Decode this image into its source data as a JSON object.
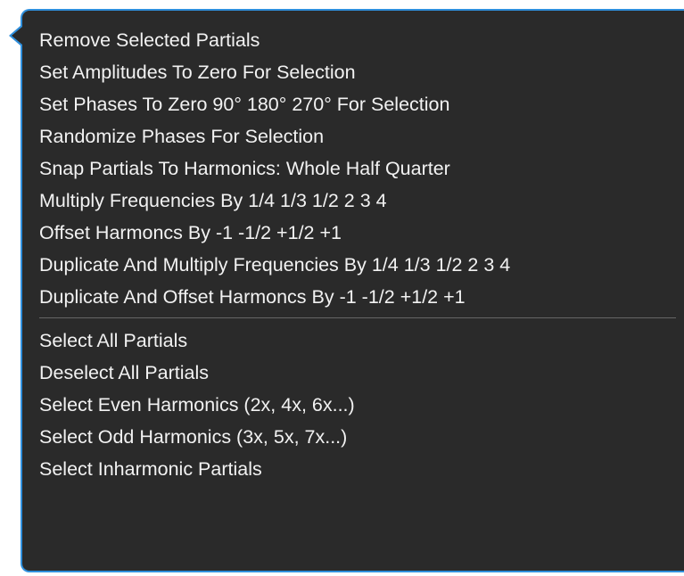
{
  "popup": {
    "border_color": "#2f8fdc",
    "background_color": "#2a2a2a"
  },
  "menu": {
    "group1": [
      "Remove Selected Partials",
      "Set Amplitudes To Zero For Selection",
      "Set Phases To Zero  90°  180°  270°   For Selection",
      "Randomize Phases For Selection",
      "Snap Partials To Harmonics:  Whole  Half  Quarter",
      "Multiply Frequencies By 1/4  1/3  1/2  2  3  4",
      "Offset Harmoncs By -1  -1/2  +1/2  +1",
      "Duplicate And Multiply Frequencies By 1/4  1/3  1/2  2  3  4",
      "Duplicate And Offset Harmoncs By -1  -1/2  +1/2  +1"
    ],
    "group2": [
      "Select All Partials",
      "Deselect All Partials",
      "Select Even Harmonics (2x, 4x, 6x...)",
      "Select Odd Harmonics (3x, 5x, 7x...)",
      "Select Inharmonic Partials"
    ]
  }
}
